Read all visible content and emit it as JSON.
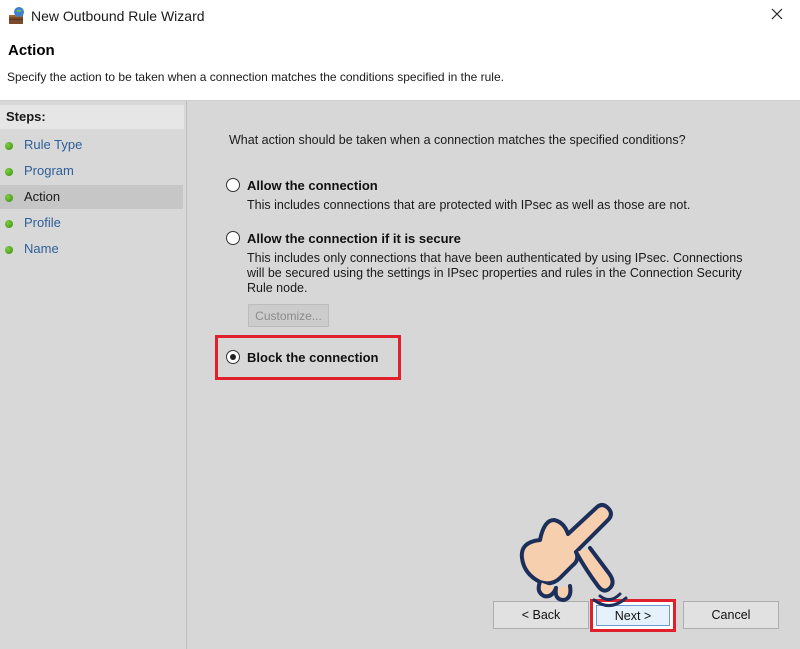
{
  "window": {
    "title": "New Outbound Rule Wizard"
  },
  "header": {
    "title": "Action",
    "subtitle": "Specify the action to be taken when a connection matches the conditions specified in the rule."
  },
  "steps": {
    "label": "Steps:",
    "items": [
      {
        "label": "Rule Type",
        "active": false
      },
      {
        "label": "Program",
        "active": false
      },
      {
        "label": "Action",
        "active": true
      },
      {
        "label": "Profile",
        "active": false
      },
      {
        "label": "Name",
        "active": false
      }
    ]
  },
  "main": {
    "question": "What action should be taken when a connection matches the specified conditions?",
    "options": [
      {
        "label": "Allow the connection",
        "description": "This includes connections that are protected with IPsec as well as those are not.",
        "checked": false
      },
      {
        "label": "Allow the connection if it is secure",
        "description_lines": [
          "This includes only connections that have been authenticated by using IPsec.  Connections",
          "will be secured using the settings in IPsec properties and rules in the Connection Security",
          "Rule node."
        ],
        "checked": false
      },
      {
        "label": "Block the connection",
        "checked": true
      }
    ],
    "customize_label": "Customize..."
  },
  "buttons": {
    "back": "< Back",
    "next": "Next >",
    "cancel": "Cancel"
  },
  "icons": {
    "app": "firewall-wizard-icon",
    "close": "close-icon",
    "step": "green-dot-icon",
    "pointer": "hand-pointer-icon"
  },
  "colors": {
    "highlight": "#e0202a",
    "step_link": "#2f5f99"
  }
}
